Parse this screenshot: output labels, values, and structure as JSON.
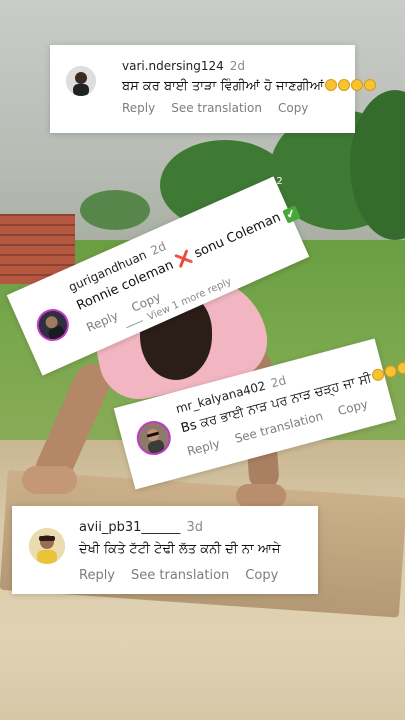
{
  "comments": [
    {
      "username": "vari.ndersing124",
      "age": "2d",
      "text": "ਬਸ ਕਰ ਬਾਈ ਤਾੜਾ ਵਿੰਗੀਆਂ ਹੋ ਜਾਣਗੀਆਂ",
      "emoji_count": 4,
      "actions": [
        "Reply",
        "See translation",
        "Copy"
      ]
    },
    {
      "username": "gurigandhuan",
      "age": "2d",
      "text_a": "Ronnie coleman",
      "cross": "❌",
      "text_b": "sonu Coleman",
      "check": "✔",
      "actions": [
        "Reply",
        "Copy"
      ],
      "more": "View 1 more reply"
    },
    {
      "username": "mr_kalyana402",
      "age": "2d",
      "text": "Bs ਕਰ ਭਾਈ ਨਾੜ ਪਰ ਨਾੜ ਚੜ੍ਹ ਜਾ ਸੀ",
      "emoji_count": 3,
      "actions": [
        "Reply",
        "See translation",
        "Copy"
      ]
    },
    {
      "username": "avii_pb31______",
      "age": "3d",
      "text": "ਦੇਖੀ ਕਿਤੇ ਟੱਟੀ ਟੇਢੀ ਲੱਤ ਕਨੀ ਦੀ ਨਾ ਆਜੇ",
      "actions": [
        "Reply",
        "See translation",
        "Copy"
      ]
    }
  ],
  "side_count": "12"
}
